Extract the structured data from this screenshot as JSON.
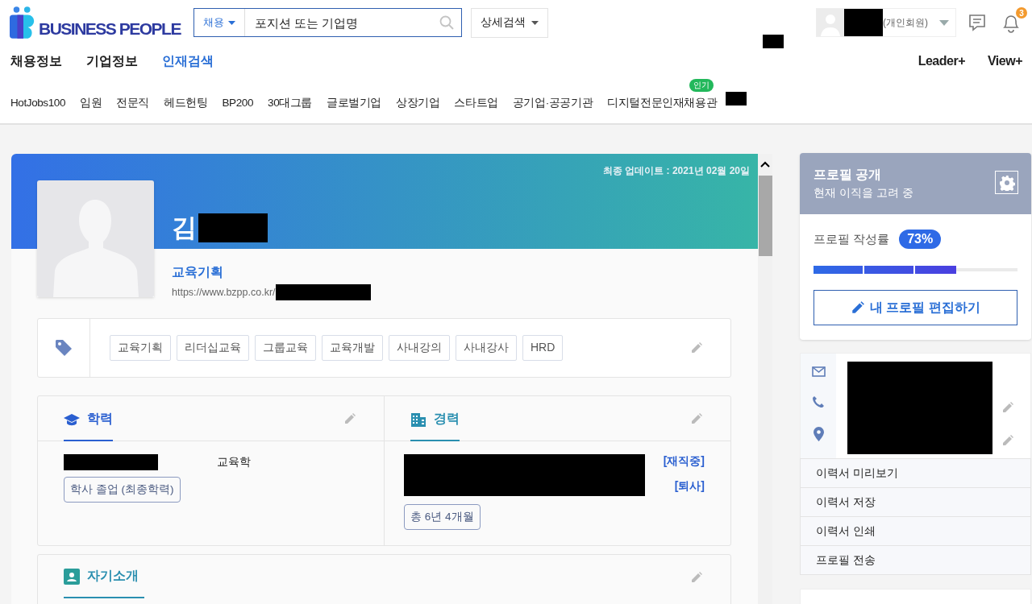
{
  "header": {
    "logo": "BUSINESS PEOPLE",
    "search": {
      "category": "채용",
      "placeholder": "포지션 또는 기업명"
    },
    "detail_search": "상세검색",
    "user": {
      "member_type": "(개인회원)"
    },
    "notification_count": "3"
  },
  "main_nav": [
    {
      "label": "채용정보",
      "selected": false
    },
    {
      "label": "기업정보",
      "selected": false
    },
    {
      "label": "인재검색",
      "selected": true
    }
  ],
  "right_nav": [
    "Leader+",
    "View+"
  ],
  "sub_nav": [
    {
      "label": "HotJobs100"
    },
    {
      "label": "임원"
    },
    {
      "label": "전문직"
    },
    {
      "label": "헤드헌팅"
    },
    {
      "label": "BP200"
    },
    {
      "label": "30대그룹"
    },
    {
      "label": "글로벌기업"
    },
    {
      "label": "상장기업"
    },
    {
      "label": "스타트업"
    },
    {
      "label": "공기업·공공기관"
    },
    {
      "label": "디지털전문인재채용관",
      "badge": "인기"
    }
  ],
  "profile": {
    "updated": "최종 업데이트 : 2021년 02월 20일",
    "name": "김",
    "title": "교육기획",
    "url": "https://www.bzpp.co.kr/"
  },
  "tags": [
    "교육기획",
    "리더십교육",
    "그룹교육",
    "교육개발",
    "사내강의",
    "사내강사",
    "HRD"
  ],
  "education": {
    "title": "학력",
    "major": "교육학",
    "badge": "학사 졸업 (최종학력)"
  },
  "career": {
    "title": "경력",
    "statuses": [
      "[재직중]",
      "[퇴사]"
    ],
    "total": "총 6년 4개월"
  },
  "intro": {
    "title": "자기소개"
  },
  "profile_panel": {
    "title": "프로필 공개",
    "subtitle": "현재 이직을 고려 중",
    "completion_label": "프로필 작성률",
    "completion_value": "73%",
    "level": 0.7,
    "edit_button": "내 프로필 편집하기"
  },
  "resume_actions": [
    "이력서 미리보기",
    "이력서 저장",
    "이력서 인쇄",
    "프로필 전송"
  ]
}
